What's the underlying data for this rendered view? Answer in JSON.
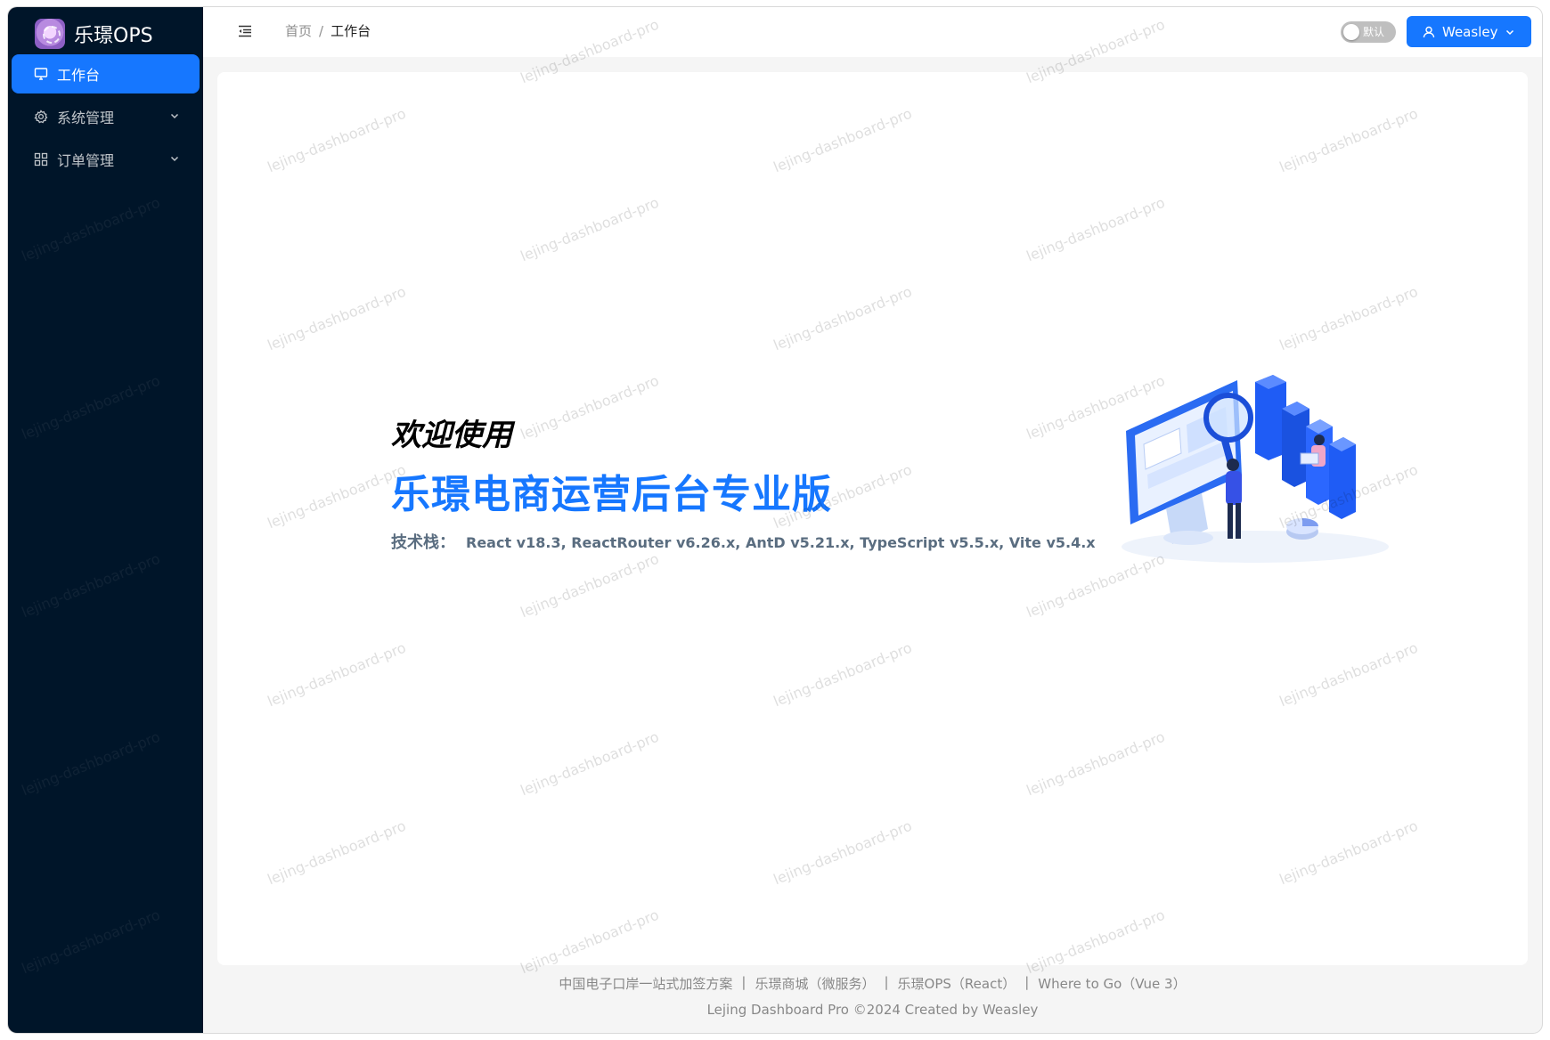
{
  "app": {
    "logo_text": "乐璟OPS"
  },
  "sidebar": {
    "items": [
      {
        "label": "工作台",
        "icon": "desktop-icon",
        "active": true
      },
      {
        "label": "系统管理",
        "icon": "setting-icon",
        "expandable": true
      },
      {
        "label": "订单管理",
        "icon": "appstore-icon",
        "expandable": true
      }
    ]
  },
  "header": {
    "breadcrumb": {
      "home": "首页",
      "separator": "/",
      "current": "工作台"
    },
    "theme_switch": {
      "label": "默认",
      "checked": false
    },
    "user": {
      "name": "Weasley"
    }
  },
  "main": {
    "welcome": "欢迎使用",
    "title": "乐璟电商运营后台专业版",
    "stack_label": "技术栈：",
    "stack_value": "React v18.3, ReactRouter v6.26.x, AntD v5.21.x, TypeScript v5.5.x, Vite v5.4.x"
  },
  "footer": {
    "links": [
      "中国电子口岸一站式加签方案",
      "乐璟商城（微服务）",
      "乐璟OPS（React）",
      "Where to Go（Vue 3）"
    ],
    "separator": "|",
    "copyright": "Lejing Dashboard Pro ©2024 Created by Weasley"
  },
  "watermark": {
    "text": "lejing-dashboard-pro"
  },
  "colors": {
    "primary": "#1677ff",
    "sider": "#001529",
    "background": "#f5f5f5"
  }
}
